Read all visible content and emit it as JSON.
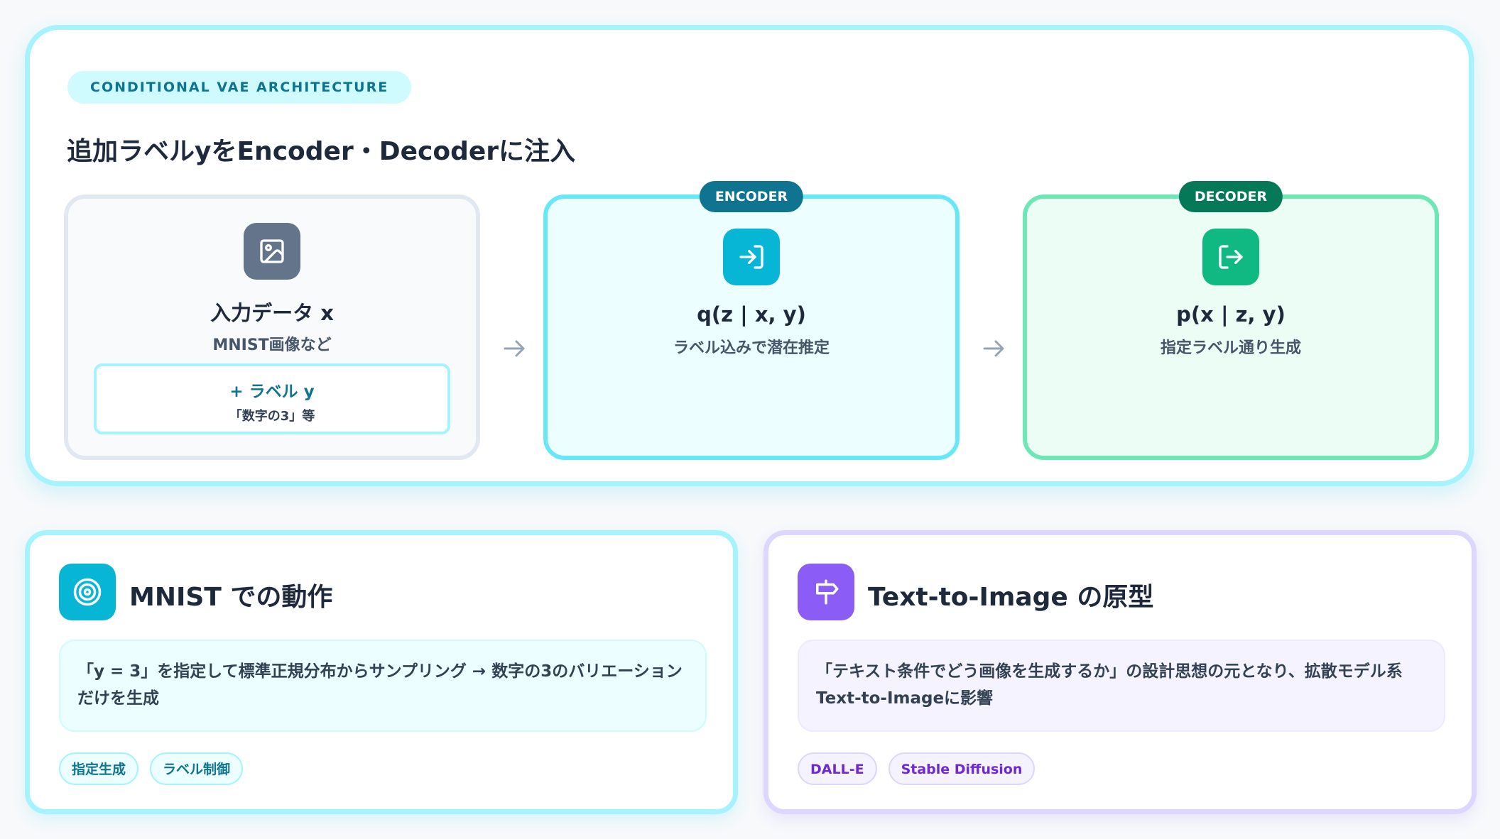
{
  "section_tag": "CONDITIONAL VAE ARCHITECTURE",
  "title": "追加ラベルyをEncoder・Decoderに注入",
  "nodes": {
    "input": {
      "title": "入力データ x",
      "subtitle": "MNIST画像など",
      "icon": "image-icon",
      "label_box": {
        "main": "+ ラベル y",
        "note": "「数字の3」等"
      }
    },
    "encoder": {
      "badge": "ENCODER",
      "title": "q(z | x, y)",
      "subtitle": "ラベル込みで潜在推定",
      "icon": "log-in-icon"
    },
    "decoder": {
      "badge": "DECODER",
      "title": "p(x | z, y)",
      "subtitle": "指定ラベル通り生成",
      "icon": "log-out-icon"
    }
  },
  "cards": {
    "mnist": {
      "title": "MNIST での動作",
      "icon": "target-icon",
      "description": "「y = 3」を指定して標準正規分布からサンプリング → 数字の3のバリエーションだけを生成",
      "tags": [
        "指定生成",
        "ラベル制御"
      ]
    },
    "t2i": {
      "title": "Text-to-Image の原型",
      "icon": "signpost-icon",
      "description": "「テキスト条件でどう画像を生成するか」の設計思想の元となり、拡散モデル系Text-to-Imageに影響",
      "tags": [
        "DALL-E",
        "Stable Diffusion"
      ]
    }
  },
  "colors": {
    "cyan_accent": "#06b6d4",
    "green_accent": "#10b981",
    "violet_accent": "#8b5cf6",
    "slate_icon": "#64748b"
  }
}
